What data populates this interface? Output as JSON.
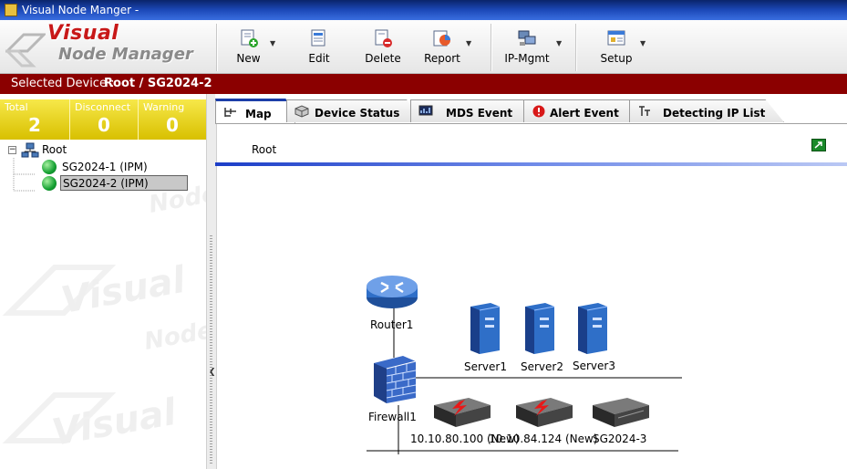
{
  "window": {
    "title": "Visual Node Manger -"
  },
  "logo": {
    "line1": "Visual",
    "line2": "Node Manager"
  },
  "toolbar": {
    "new_label": "New",
    "edit_label": "Edit",
    "delete_label": "Delete",
    "report_label": "Report",
    "ipmgmt_label": "IP-Mgmt",
    "setup_label": "Setup"
  },
  "selected": {
    "prefix": "Selected Device :",
    "path": "Root / SG2024-2"
  },
  "stats": {
    "total_label": "Total",
    "total_value": "2",
    "disconnect_label": "Disconnect",
    "disconnect_value": "0",
    "warning_label": "Warning",
    "warning_value": "0"
  },
  "tree": {
    "root": "Root",
    "items": [
      {
        "label": "SG2024-1 (IPM)"
      },
      {
        "label": "SG2024-2 (IPM)"
      }
    ]
  },
  "tabs": [
    {
      "label": "Map"
    },
    {
      "label": "Device Status"
    },
    {
      "label": "MDS Event"
    },
    {
      "label": "Alert Event"
    },
    {
      "label": "Detecting IP List"
    }
  ],
  "map": {
    "breadcrumb": "Root",
    "nodes": {
      "router": "Router1",
      "firewall": "Firewall1",
      "server1": "Server1",
      "server2": "Server2",
      "server3": "Server3",
      "dev1": "10.10.80.100 (New)",
      "dev2": "10.10.84.124 (New)",
      "dev3": "SG2024-3"
    }
  },
  "colors": {
    "selected_bar": "#8b0000",
    "stats_bg": "#e8d820",
    "tab_accent": "#1c3ea8"
  }
}
